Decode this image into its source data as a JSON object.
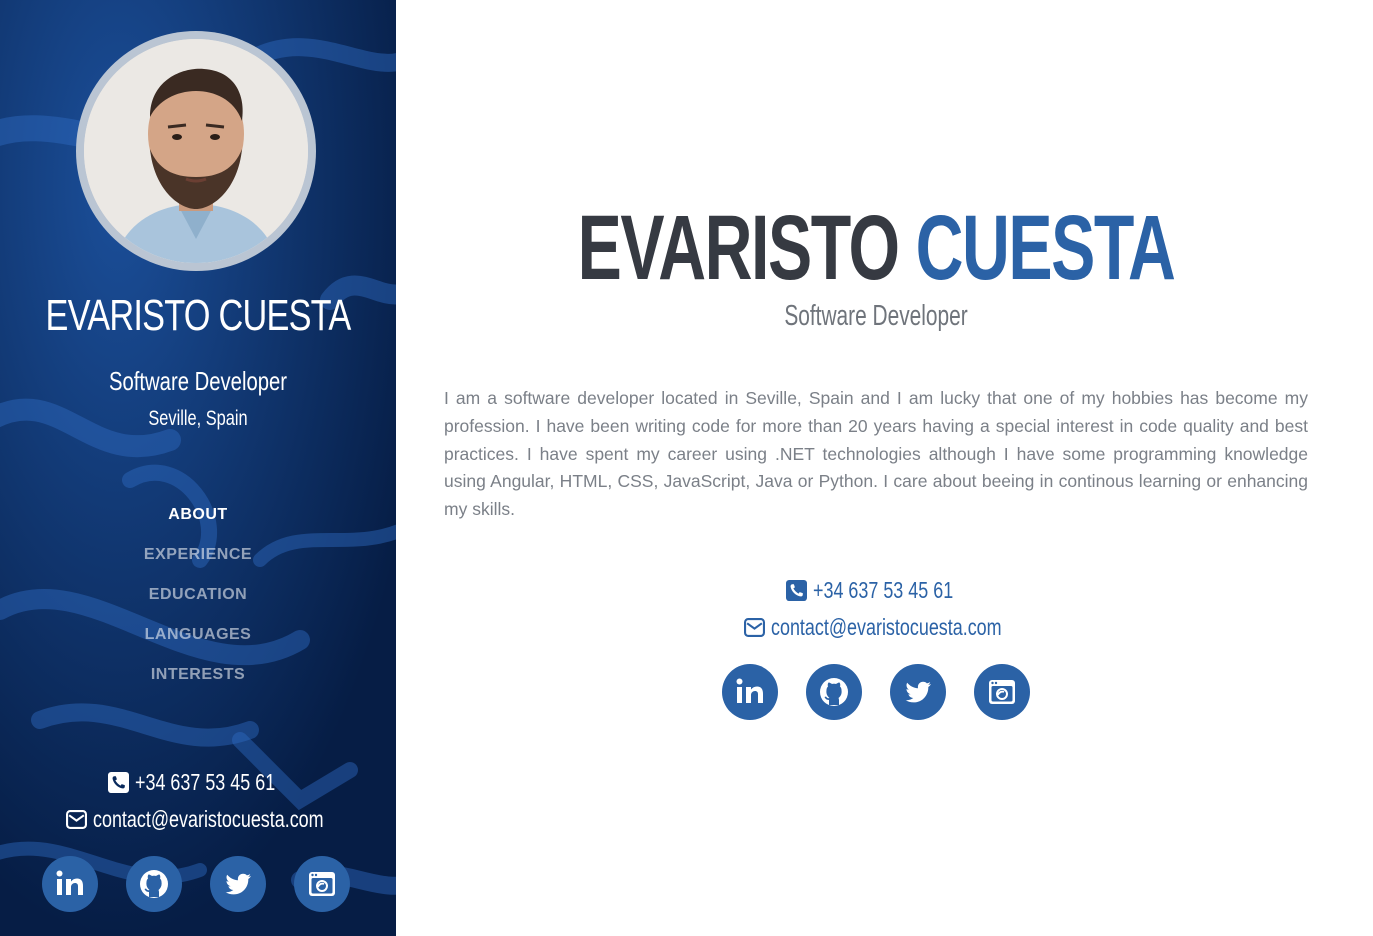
{
  "sidebar": {
    "avatar_alt": "",
    "name": "EVARISTO CUESTA",
    "role": "Software Developer",
    "location": "Seville, Spain",
    "nav": [
      {
        "label": "ABOUT",
        "active": true
      },
      {
        "label": "EXPERIENCE",
        "active": false
      },
      {
        "label": "EDUCATION",
        "active": false
      },
      {
        "label": "LANGUAGES",
        "active": false
      },
      {
        "label": "INTERESTS",
        "active": false
      }
    ],
    "phone": "+34 637 53 45 61",
    "email": "contact@evaristocuesta.com",
    "socials": [
      {
        "icon": "linkedin-icon"
      },
      {
        "icon": "github-icon"
      },
      {
        "icon": "twitter-icon"
      },
      {
        "icon": "blog-icon"
      }
    ]
  },
  "main": {
    "first_name": "EVARISTO",
    "last_name": "CUESTA",
    "role": "Software Developer",
    "bio": "I am a software developer located in Seville, Spain and I am lucky that one of my hobbies has become my profession. I have been writing code for more than 20 years having a special interest in code quality and best practices. I have spent my career using .NET technologies although I have some programming knowledge using Angular, HTML, CSS, JavaScript, Java or Python. I care about beeing in continous learning or enhancing my skills.",
    "phone": "+34 637 53 45 61",
    "email": "contact@evaristocuesta.com"
  },
  "colors": {
    "sidebar_bg": "#0a2a5c",
    "accent": "#2b62a6",
    "heading_dark": "#363a42",
    "body_text": "#7b8088",
    "nav_inactive": "rgba(255,255,255,0.55)"
  }
}
